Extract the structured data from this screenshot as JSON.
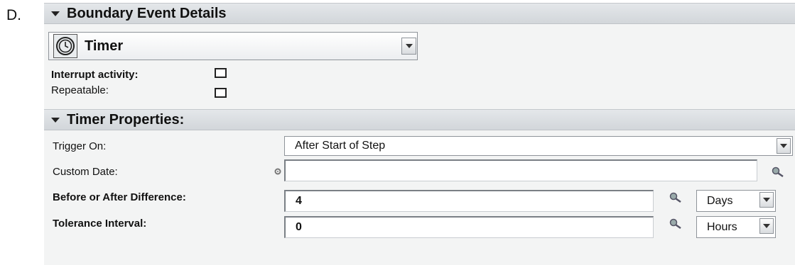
{
  "option_letter": "D.",
  "boundary_section": {
    "title": "Boundary Event Details",
    "event_type": "Timer",
    "interrupt_label": "Interrupt activity:",
    "interrupt_checked": false,
    "repeatable_label": "Repeatable:",
    "repeatable_checked": false
  },
  "timer_section": {
    "title": "Timer Properties:",
    "trigger_on_label": "Trigger On:",
    "trigger_on_value": "After Start of Step",
    "custom_date_label": "Custom Date:",
    "custom_date_value": "",
    "difference_label": "Before or After Difference:",
    "difference_value": "4",
    "difference_unit": "Days",
    "tolerance_label": "Tolerance Interval:",
    "tolerance_value": "0",
    "tolerance_unit": "Hours"
  },
  "icons": {
    "timer": "clock-icon",
    "picker": "magnifier-icon",
    "custom_date_marker": "gear-icon"
  }
}
